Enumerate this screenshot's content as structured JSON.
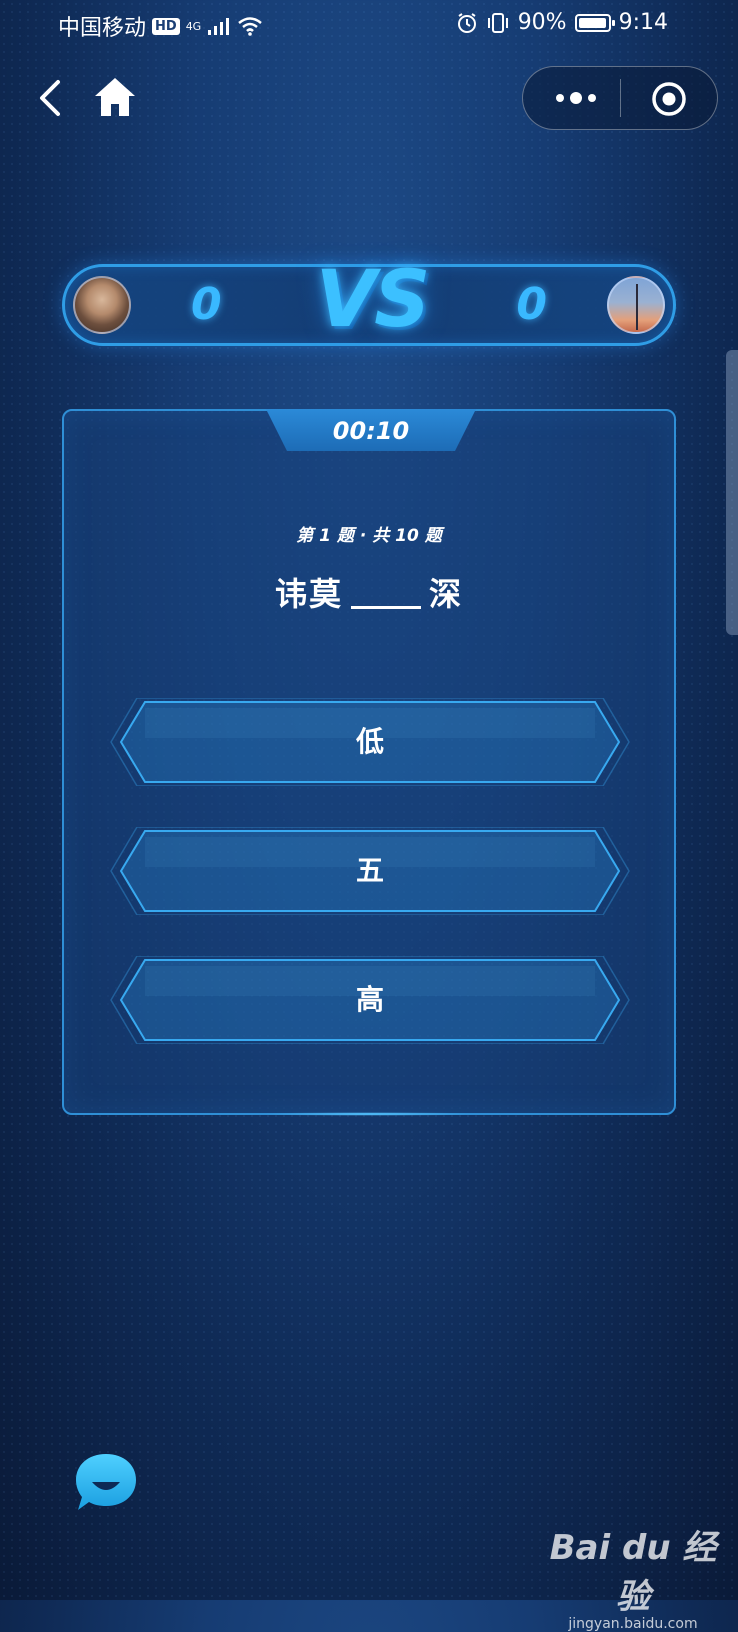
{
  "status_bar": {
    "carrier": "中国移动",
    "hd_badge": "HD",
    "network": "4G",
    "battery": "90%",
    "time": "9:14"
  },
  "nav": {
    "back_icon": "chevron-left-icon",
    "home_icon": "home-icon",
    "more_icon": "more-dots-icon",
    "close_icon": "target-close-icon"
  },
  "battle": {
    "left_score": "0",
    "vs_label": "VS",
    "right_score": "0"
  },
  "quiz": {
    "timer": "00:10",
    "progress": "第 1 题 · 共 10 题",
    "question_prefix": "讳莫",
    "question_suffix": "深",
    "options": [
      {
        "label": "低"
      },
      {
        "label": "五"
      },
      {
        "label": "高"
      }
    ]
  },
  "watermark": {
    "logo": "Bai du 经验",
    "url": "jingyan.baidu.com"
  },
  "colors": {
    "accent": "#39b8ff",
    "panel_border": "#2f8fd6",
    "background": "#163c73"
  }
}
